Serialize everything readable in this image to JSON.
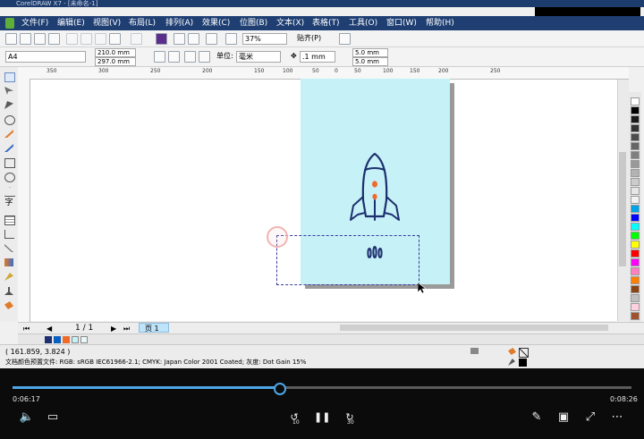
{
  "window": {
    "title_fragment": "CorelDRAW X7 - [未命名-1]"
  },
  "menu": [
    "文件(F)",
    "编辑(E)",
    "视图(V)",
    "布局(L)",
    "排列(A)",
    "效果(C)",
    "位图(B)",
    "文本(X)",
    "表格(T)",
    "工具(O)",
    "窗口(W)",
    "帮助(H)"
  ],
  "toolbar1": {
    "zoom": "37%",
    "snap": "贴齐(P)"
  },
  "toolbar2": {
    "page_size": "A4",
    "width": "210.0 mm",
    "height": "297.0 mm",
    "unit_label": "单位:",
    "unit": "毫米",
    "nudge": ".1 mm",
    "dup_x": "5.0 mm",
    "dup_y": "5.0 mm"
  },
  "ruler_ticks": [
    "350",
    "300",
    "250",
    "200",
    "150",
    "100",
    "50",
    "0",
    "50",
    "100",
    "150",
    "200",
    "250"
  ],
  "pagebar": {
    "page_count": "1 / 1",
    "page_tab": "页 1"
  },
  "status": {
    "coords": "( 161.859, 3.824 )",
    "color_profile": "文档颜色预置文件: RGB: sRGB IEC61966-2.1; CMYK: Japan Color 2001 Coated; 灰度: Dot Gain 15%"
  },
  "palette_colors": [
    "#ffffff",
    "#000000",
    "#1a1a1a",
    "#333333",
    "#4d4d4d",
    "#666666",
    "#808080",
    "#999999",
    "#b3b3b3",
    "#cccccc",
    "#e6e6e6",
    "#f2f2f2",
    "#00a2e8",
    "#0000ff",
    "#00ffff",
    "#00ff00",
    "#ffff00",
    "#ff0000",
    "#ff00ff",
    "#ff7fbf",
    "#ff8000",
    "#8b4513",
    "#c0c0c0",
    "#ffd0e0",
    "#a0522d"
  ],
  "rocket": {
    "body_color": "#1d2f6f",
    "window_color": "#f06a2a"
  },
  "player": {
    "elapsed": "0:06:17",
    "duration": "0:08:26",
    "progress": 0.43,
    "skip_back": "10",
    "skip_forward": "30"
  }
}
